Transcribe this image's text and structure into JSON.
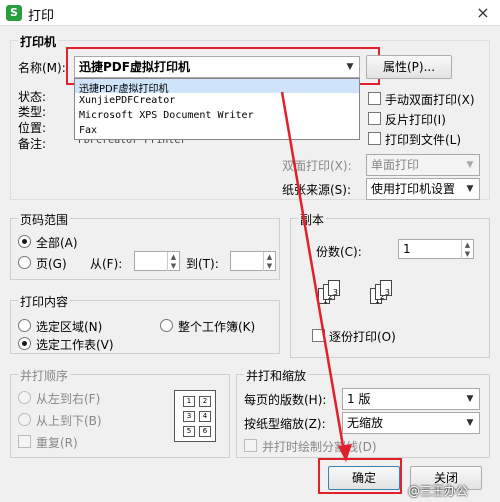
{
  "window": {
    "title": "打印",
    "app_icon_letter": "S",
    "close_label": "×"
  },
  "printer": {
    "group_label": "打印机",
    "name_label": "名称(M):",
    "selected": "迅捷PDF虚拟打印机",
    "properties_btn": "属性(P)...",
    "status_label": "状态:",
    "type_label": "类型:",
    "location_label": "位置:",
    "comment_label": "备注:",
    "comment_value": "PDFCreator Printer",
    "dropdown_options": [
      "迅捷PDF虚拟打印机",
      "XunjiePDFCreator",
      "Microsoft XPS Document Writer",
      "Fax"
    ]
  },
  "options": {
    "manual_duplex": "手动双面打印(X)",
    "reverse_print": "反片打印(I)",
    "print_to_file": "打印到文件(L)",
    "duplex_label": "双面打印(X):",
    "duplex_value": "单面打印",
    "paper_source_label": "纸张来源(S):",
    "paper_source_value": "使用打印机设置"
  },
  "page_range": {
    "title": "页码范围",
    "all": "全部(A)",
    "pages": "页(G)",
    "from_label": "从(F):",
    "to_label": "到(T):"
  },
  "copies": {
    "title": "副本",
    "count_label": "份数(C):",
    "count_value": "1",
    "collate": "逐份打印(O)"
  },
  "print_content": {
    "title": "打印内容",
    "selection": "选定区域(N)",
    "whole_workbook": "整个工作簿(K)",
    "active_sheet": "选定工作表(V)"
  },
  "print_order": {
    "title": "并打顺序",
    "left_to_right": "从左到右(F)",
    "top_to_bottom": "从上到下(B)",
    "repeat": "重复(R)",
    "grid_numbers": [
      "1",
      "2",
      "3",
      "4",
      "5",
      "6"
    ]
  },
  "scaling": {
    "title": "并打和缩放",
    "pages_per_sheet_label": "每页的版数(H):",
    "pages_per_sheet_value": "1 版",
    "scale_label": "按纸型缩放(Z):",
    "scale_value": "无缩放",
    "draw_borders": "并打时绘制分割线(D)"
  },
  "buttons": {
    "ok": "确定",
    "close": "关闭"
  },
  "watermark": "@三王办公",
  "colors": {
    "highlight": "#e0202a",
    "selection_bg": "#cfe3fb"
  }
}
